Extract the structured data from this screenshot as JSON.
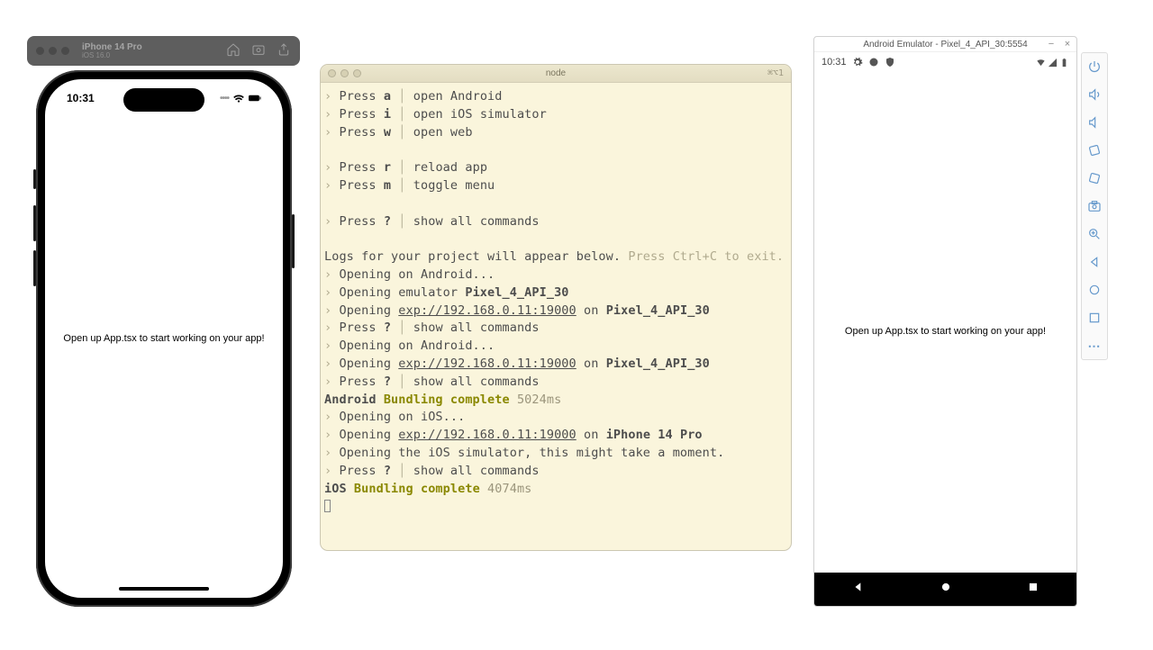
{
  "ios_titlebar": {
    "device_name": "iPhone 14 Pro",
    "os_version": "iOS 16.0"
  },
  "iphone": {
    "time": "10:31",
    "app_text": "Open up App.tsx to start working on your app!"
  },
  "terminal": {
    "title": "node",
    "shortcut": "⌘⌥1",
    "lines": [
      {
        "t": "cmd",
        "key": "a",
        "desc": "open Android"
      },
      {
        "t": "cmd",
        "key": "i",
        "desc": "open iOS simulator"
      },
      {
        "t": "cmd",
        "key": "w",
        "desc": "open web"
      },
      {
        "t": "blank"
      },
      {
        "t": "cmd",
        "key": "r",
        "desc": "reload app"
      },
      {
        "t": "cmd",
        "key": "m",
        "desc": "toggle menu"
      },
      {
        "t": "blank"
      },
      {
        "t": "cmd",
        "key": "?",
        "desc": "show all commands"
      },
      {
        "t": "blank"
      },
      {
        "t": "logs",
        "text": "Logs for your project will appear below. ",
        "faint": "Press Ctrl+C to exit."
      },
      {
        "t": "log",
        "text": "Opening on Android..."
      },
      {
        "t": "log_emul",
        "text": "Opening emulator ",
        "bold": "Pixel_4_API_30"
      },
      {
        "t": "log_open",
        "text": "Opening ",
        "url": "exp://192.168.0.11:19000",
        "mid": " on ",
        "bold": "Pixel_4_API_30"
      },
      {
        "t": "cmd",
        "key": "?",
        "desc": "show all commands"
      },
      {
        "t": "log",
        "text": "Opening on Android..."
      },
      {
        "t": "log_open",
        "text": "Opening ",
        "url": "exp://192.168.0.11:19000",
        "mid": " on ",
        "bold": "Pixel_4_API_30"
      },
      {
        "t": "cmd",
        "key": "?",
        "desc": "show all commands"
      },
      {
        "t": "bundle",
        "plat": "Android",
        "status": "Bundling complete",
        "time": "5024ms"
      },
      {
        "t": "log",
        "text": "Opening on iOS..."
      },
      {
        "t": "log_open",
        "text": "Opening ",
        "url": "exp://192.168.0.11:19000",
        "mid": " on ",
        "bold": "iPhone 14 Pro"
      },
      {
        "t": "log",
        "text": "Opening the iOS simulator, this might take a moment."
      },
      {
        "t": "cmd",
        "key": "?",
        "desc": "show all commands"
      },
      {
        "t": "bundle",
        "plat": "iOS",
        "status": "Bundling complete",
        "time": "4074ms"
      }
    ]
  },
  "android": {
    "title": "Android Emulator - Pixel_4_API_30:5554",
    "time": "10:31",
    "app_text": "Open up App.tsx to start working on your app!"
  }
}
